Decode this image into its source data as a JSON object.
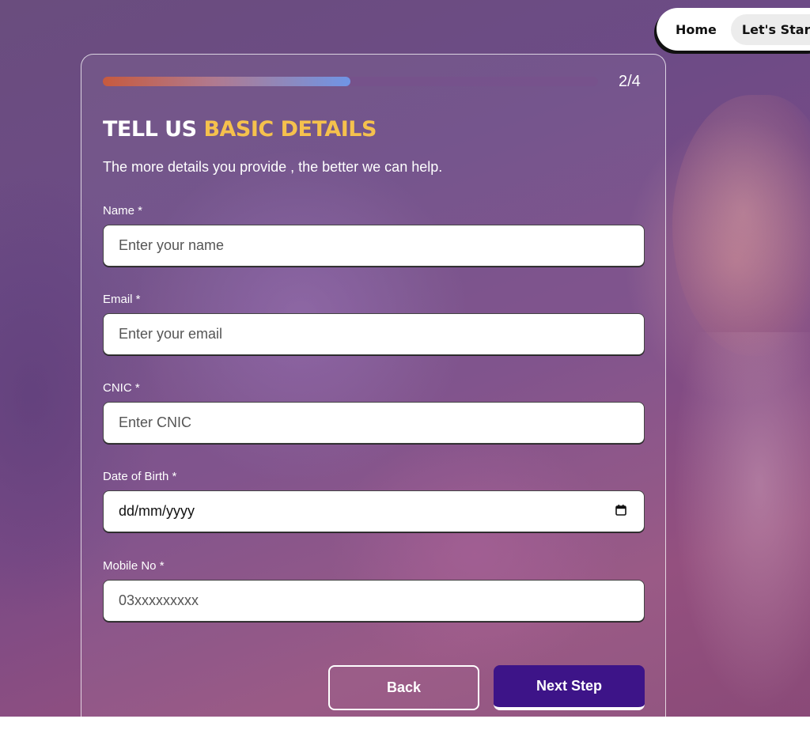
{
  "nav": {
    "items": [
      {
        "label": "Home"
      },
      {
        "label": "Let's Start"
      }
    ]
  },
  "progress": {
    "step_text": "2/4",
    "fraction": 0.5
  },
  "heading": {
    "title_part1": "TELL US ",
    "title_part2": "BASIC DETAILS",
    "subtitle": "The more details you provide , the better we can help."
  },
  "form": {
    "fields": [
      {
        "label": "Name *",
        "placeholder": "Enter your name"
      },
      {
        "label": "Email *",
        "placeholder": "Enter your email"
      },
      {
        "label": "CNIC *",
        "placeholder": "Enter CNIC"
      },
      {
        "label": "Date of Birth *",
        "value": "dd/mm/yyyy",
        "icon": "calendar-icon"
      },
      {
        "label": "Mobile No *",
        "placeholder": "03xxxxxxxxx"
      }
    ]
  },
  "buttons": {
    "back": "Back",
    "next": "Next Step"
  },
  "colors": {
    "accent_yellow": "#f5c14d",
    "primary_button": "#3d1488"
  }
}
